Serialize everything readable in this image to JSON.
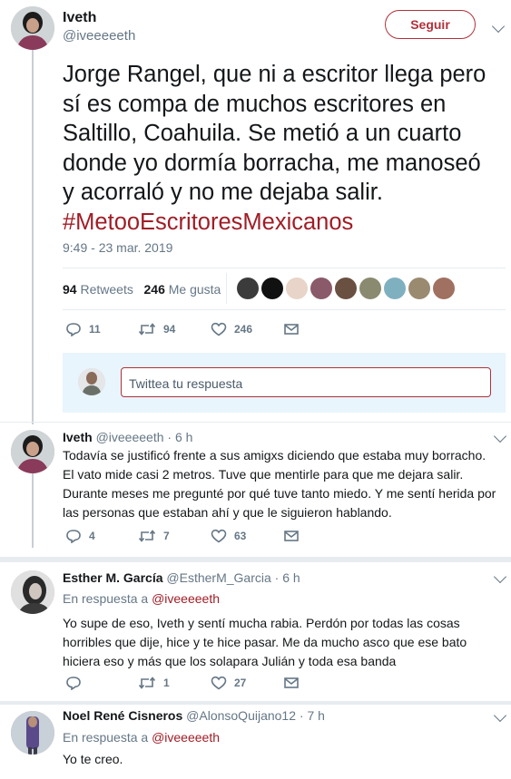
{
  "main_tweet": {
    "name": "Iveth",
    "handle": "@iveeeeeth",
    "follow_label": "Seguir",
    "text": "Jorge Rangel, que ni a escritor llega pero sí es compa de muchos escritores en Saltillo, Coahuila. Se metió a un cuarto donde yo dormía borracha, me manoseó y acorraló y no me dejaba salir.",
    "hashtag": "#MetooEscritoresMexicanos",
    "timestamp": "9:49 - 23 mar. 2019",
    "retweets_count": "94",
    "retweets_label": "Retweets",
    "likes_count": "246",
    "likes_label": "Me gusta",
    "actions": {
      "replies": "11",
      "retweets": "94",
      "likes": "246"
    },
    "reply_placeholder": "Twittea tu respuesta"
  },
  "replies": [
    {
      "name": "Iveth",
      "handle": "@iveeeeeth",
      "time": "· 6 h",
      "text": "Todavía se justificó frente a sus amigxs diciendo que estaba muy borracho. El vato mide casi 2 metros. Tuve que mentirle para que me dejara salir. Durante meses me pregunté por qué tuve tanto miedo. Y me sentí herida por las personas que estaban ahí y que le siguieron hablando.",
      "actions": {
        "replies": "4",
        "retweets": "7",
        "likes": "63"
      }
    },
    {
      "name": "Esther M. García",
      "handle": "@EstherM_Garcia",
      "time": "· 6 h",
      "reply_to_label": "En respuesta a",
      "reply_to_handle": "@iveeeeeth",
      "text": "Yo supe de eso, Iveth y sentí mucha rabia. Perdón por todas las cosas horribles que dije, hice y te hice pasar. Me da mucho asco que ese bato hiciera eso y más que los solapara Julián y toda esa banda",
      "actions": {
        "replies": "",
        "retweets": "1",
        "likes": "27"
      }
    },
    {
      "name": "Noel René Cisneros",
      "handle": "@AlonsoQuijano12",
      "time": "· 7 h",
      "reply_to_label": "En respuesta a",
      "reply_to_handle": "@iveeeeeth",
      "text": "Yo te creo."
    }
  ],
  "colors": {
    "accent": "#a01d26",
    "muted": "#657786",
    "divider": "#e6ecf0",
    "reply_area": "#e8f5fd"
  },
  "icons": [
    "reply-icon",
    "retweet-icon",
    "like-icon",
    "message-icon",
    "chevron-down-icon"
  ]
}
